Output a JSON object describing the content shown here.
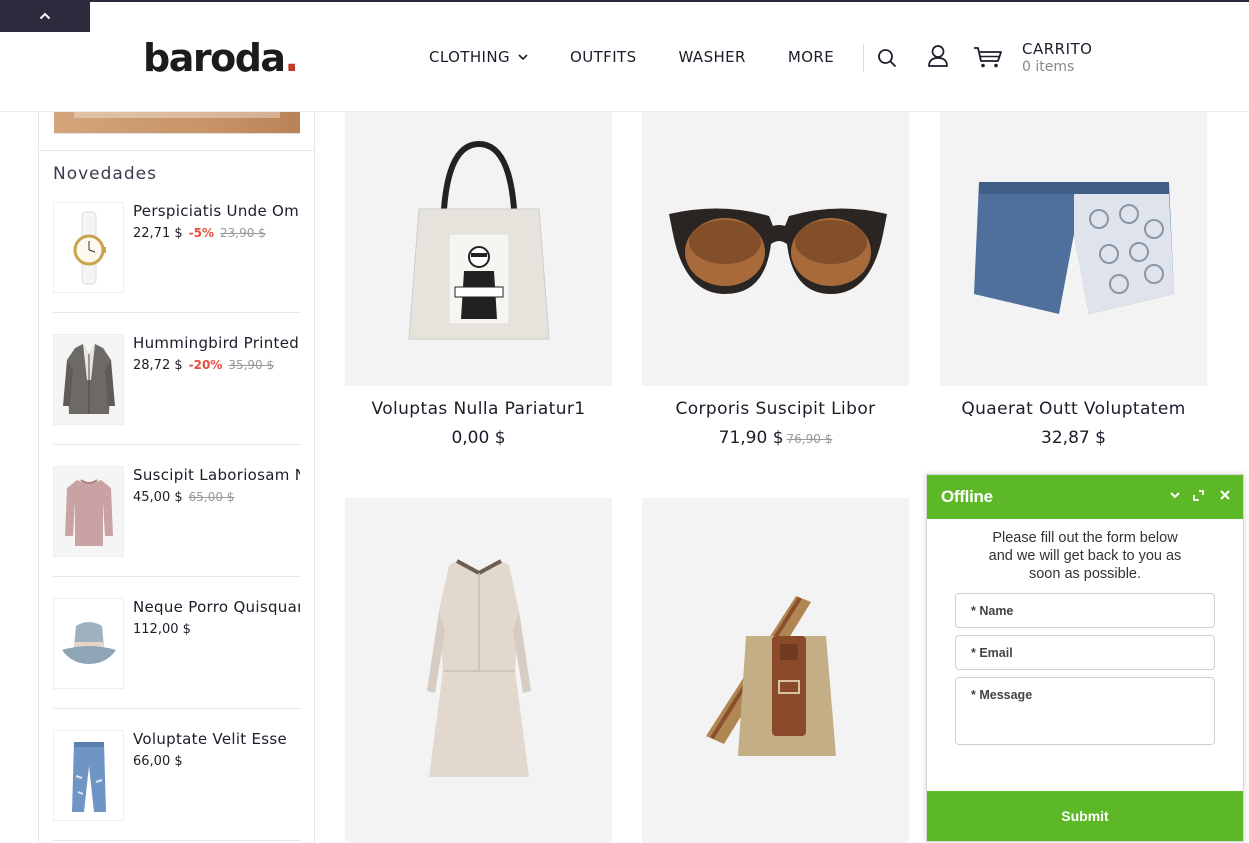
{
  "header": {
    "logo_text": "baroda",
    "logo_dot": ".",
    "nav": [
      {
        "label": "CLOTHING",
        "has_dropdown": true
      },
      {
        "label": "OUTFITS",
        "has_dropdown": false
      },
      {
        "label": "WASHER",
        "has_dropdown": false
      },
      {
        "label": "MORE",
        "has_dropdown": false
      }
    ],
    "cart_label": "CARRITO",
    "cart_count": "0 items",
    "icons": [
      "chevron-up-icon",
      "search-icon",
      "user-icon",
      "cart-icon"
    ]
  },
  "sidebar": {
    "title": "Novedades",
    "items": [
      {
        "name": "Perspiciatis Unde Omnis",
        "price": "22,71 $",
        "discount": "-5%",
        "old_price": "23,90 $",
        "thumb": "watch"
      },
      {
        "name": "Hummingbird Printed",
        "price": "28,72 $",
        "discount": "-20%",
        "old_price": "35,90 $",
        "thumb": "blazer"
      },
      {
        "name": "Suscipit Laboriosam Nisi",
        "price": "45,00 $",
        "discount": "",
        "old_price": "65,00 $",
        "thumb": "sweater"
      },
      {
        "name": "Neque Porro Quisquam",
        "price": "112,00 $",
        "discount": "",
        "old_price": "",
        "thumb": "hat"
      },
      {
        "name": "Voluptate Velit Esse",
        "price": "66,00 $",
        "discount": "",
        "old_price": "",
        "thumb": "jeans"
      }
    ]
  },
  "products": [
    {
      "name": "Voluptas Nulla Pariatur1",
      "price": "0,00 $",
      "old_price": "",
      "image": "tote-bag"
    },
    {
      "name": "Corporis Suscipit Libor",
      "price": "71,90 $",
      "old_price": "76,90 $",
      "image": "sunglasses"
    },
    {
      "name": "Quaerat Outt Voluptatem",
      "price": "32,87 $",
      "old_price": "",
      "image": "denim-shorts"
    },
    {
      "name": "",
      "price": "",
      "old_price": "",
      "image": "dress"
    },
    {
      "name": "",
      "price": "",
      "old_price": "",
      "image": "messenger-bag"
    }
  ],
  "chat": {
    "status": "Offline",
    "message_line1": "Please fill out the form below",
    "message_line2": "and we will get back to you as",
    "message_line3": "soon as possible.",
    "name_label": "* Name",
    "email_label": "* Email",
    "message_label": "* Message",
    "submit_label": "Submit",
    "accent": "#5cb827"
  },
  "colors": {
    "dark": "#2b2b3d",
    "discount": "#e74c3c",
    "logo_dot": "#c0392b"
  }
}
